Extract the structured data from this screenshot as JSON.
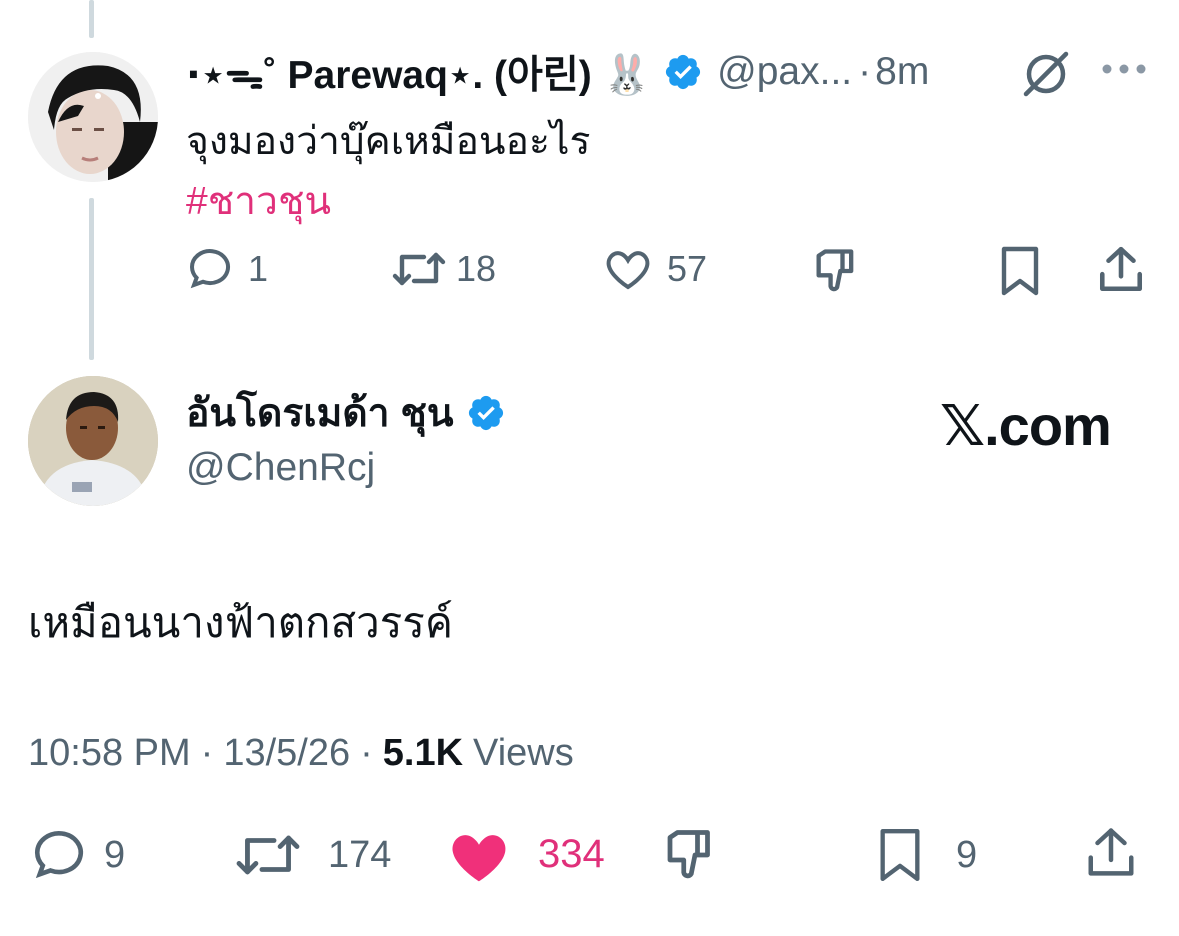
{
  "parent_tweet": {
    "display_name": "⋅⋆ᯓ˚ Parewaq⋆. (아린) 🐰",
    "handle": "@pax...",
    "separator": "·",
    "time": "8m",
    "text": "จุงมองว่าบุ๊คเหมือนอะไร",
    "hashtag": "#ชาวชุน",
    "actions": {
      "replies": "1",
      "retweets": "18",
      "likes": "57"
    }
  },
  "main_tweet": {
    "display_name": "อันโดรเมด้า ชุน",
    "handle": "@ChenRcj",
    "brand": "𝕏.com",
    "text": "เหมือนนางฟ้าตกสวรรค์",
    "meta": {
      "time": "10:58 PM",
      "sep1": "·",
      "date": "13/5/26",
      "sep2": "·",
      "views_count": "5.1K",
      "views_label": "Views"
    },
    "actions": {
      "replies": "9",
      "retweets": "174",
      "likes": "334",
      "bookmarks": "9"
    }
  },
  "colors": {
    "verified": "#1d9bf0",
    "hashtag": "#e0307a",
    "like_active": "#f0307a",
    "muted": "#536471"
  }
}
